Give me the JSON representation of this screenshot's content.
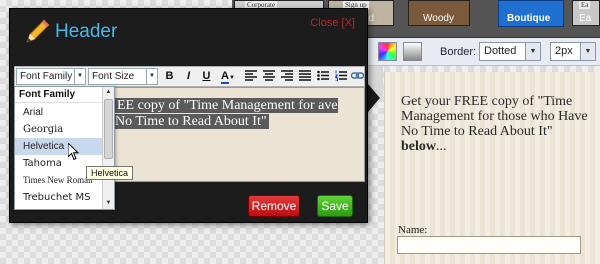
{
  "background": {
    "theme_strip": {
      "tags": [
        "Corporate",
        "Sign up",
        "Ea"
      ],
      "themes": [
        "Wilfred",
        "Woody",
        "Boutique",
        "Ea"
      ],
      "selected": "Boutique"
    },
    "style_bar": {
      "border_label": "Border:",
      "border_value": "Dotted",
      "width_value": "2px"
    },
    "card": {
      "headline": "Get your FREE copy of \"Time Management for those who Have No Time to Read About It\"",
      "headline_bold": "below",
      "headline_end": "...",
      "name_label": "Name:"
    }
  },
  "panel": {
    "title": "Header",
    "close_label": "Close [X]",
    "toolbar": {
      "font_family": "Font Family",
      "font_size": "Font Size",
      "bold": "B",
      "italic": "I",
      "underline": "U",
      "text_color": "A"
    },
    "editor_text": "EE copy of \"Time Management for ave No Time to Read About It\"",
    "remove_label": "Remove",
    "save_label": "Save"
  },
  "font_dropdown": {
    "header": "Font Family",
    "items": [
      "Arial",
      "Georgia",
      "Helvetica",
      "Tahoma",
      "Times New Roman",
      "Trebuchet MS"
    ],
    "hovered": "Helvetica"
  },
  "tooltip": "Helvetica",
  "colors": {
    "panel_bg": "#1c1c1c",
    "title_blue": "#47b8e8",
    "close_red": "#b8262b",
    "remove_red": "#c8181c",
    "save_green": "#3fae1f",
    "card_beige": "#ebe3d4",
    "selected_theme_blue": "#1f6fd0"
  }
}
